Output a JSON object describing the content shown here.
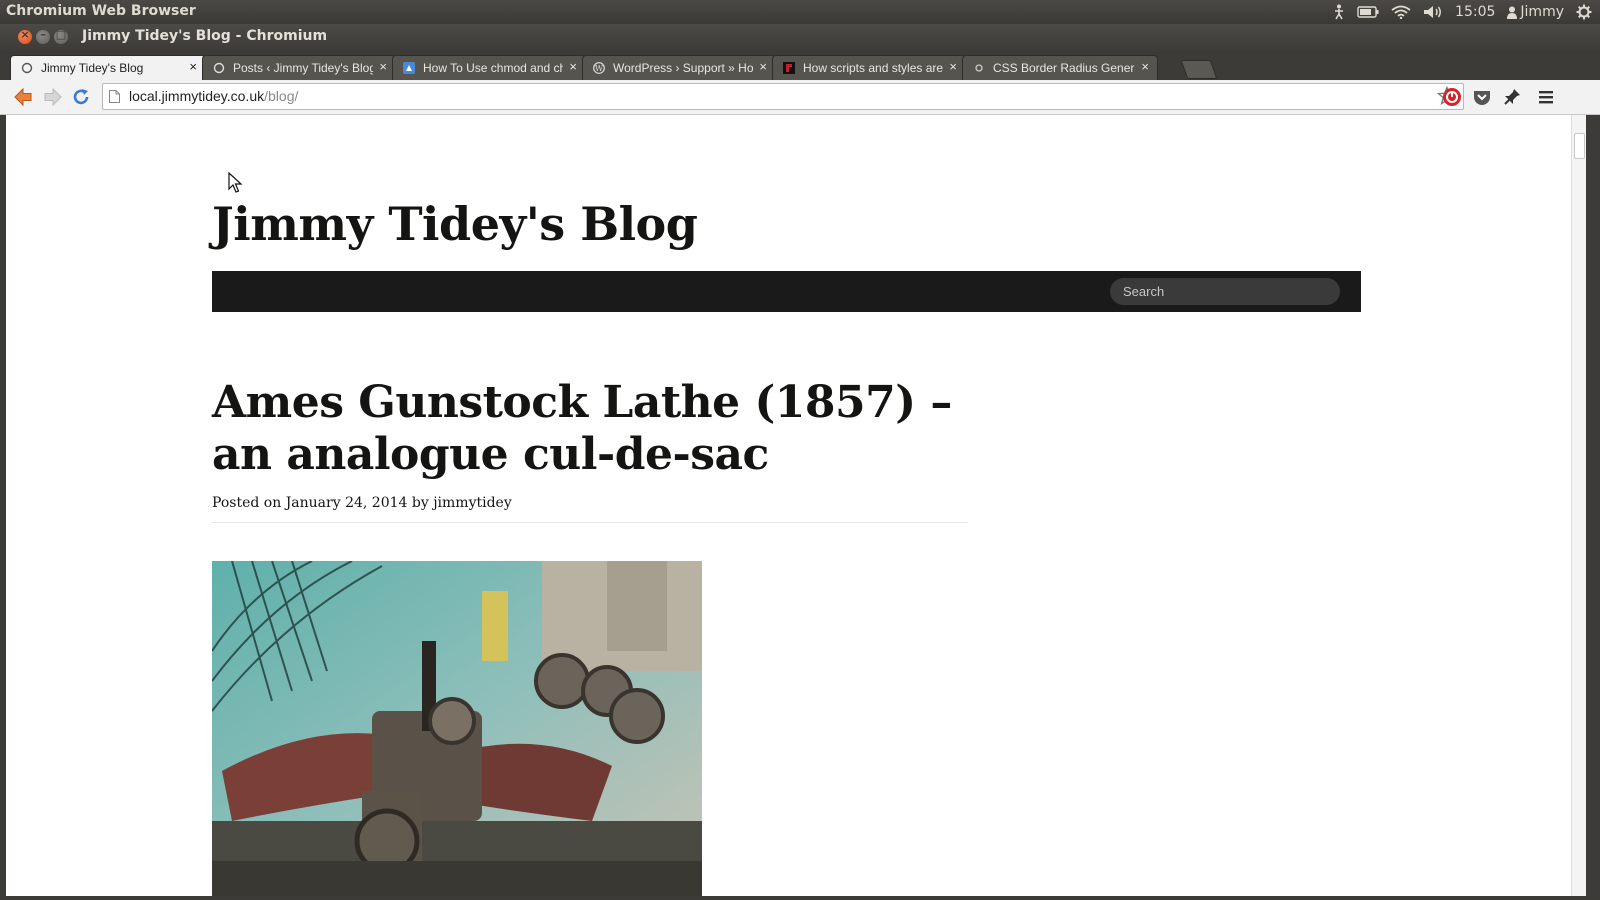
{
  "panel": {
    "app_name": "Chromium Web Browser",
    "clock": "15:05",
    "user": "Jimmy",
    "icons": [
      "accessibility-icon",
      "battery-icon",
      "wifi-icon",
      "volume-icon",
      "user-icon",
      "gear-icon"
    ]
  },
  "window": {
    "title": "Jimmy Tidey's Blog - Chromium"
  },
  "tabs": [
    {
      "title": "Jimmy Tidey's Blog",
      "close": "×",
      "active": true
    },
    {
      "title": "Posts ‹ Jimmy Tidey's Blog",
      "close": "×",
      "active": false
    },
    {
      "title": "How To Use chmod and chown",
      "close": "×",
      "active": false
    },
    {
      "title": "WordPress › Support » How",
      "close": "×",
      "active": false
    },
    {
      "title": "How scripts and styles are",
      "close": "×",
      "active": false
    },
    {
      "title": "CSS Border Radius Generator",
      "close": "×",
      "active": false
    }
  ],
  "omnibox": {
    "host": "local.jimmytidey.co.uk",
    "path": "/blog/"
  },
  "page": {
    "site_title": "Jimmy Tidey's Blog",
    "search_placeholder": "Search",
    "post_title": "Ames Gunstock Lathe (1857) – an analogue cul-de-sac",
    "meta_prefix": "Posted on",
    "meta_date": "January 24, 2014",
    "meta_by": "by",
    "meta_author": "jimmytidey"
  },
  "colors": {
    "panel_bg": "#3c3b37",
    "close_button": "#df4a16",
    "nav_bar": "#1a1a1a",
    "site_text": "#141412"
  }
}
